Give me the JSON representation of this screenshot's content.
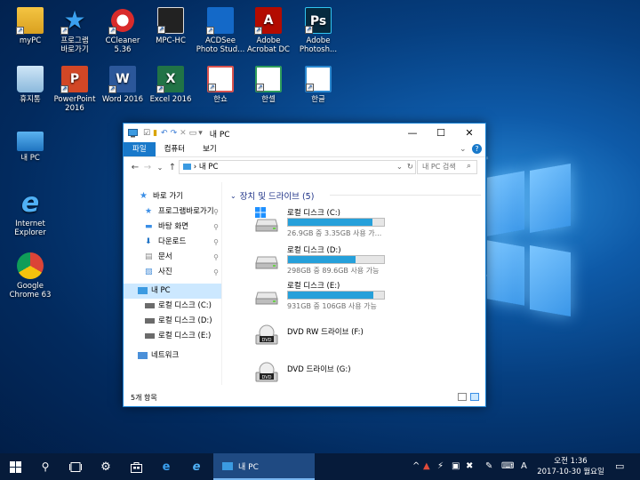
{
  "desktop_icons": [
    {
      "label": "myPC",
      "icon": "user-folder-icon"
    },
    {
      "label": "프로그램\n바로가기",
      "icon": "star-shortcut-icon"
    },
    {
      "label": "CCleaner\n5.36",
      "icon": "ccleaner-icon"
    },
    {
      "label": "MPC-HC",
      "icon": "mpc-hc-icon"
    },
    {
      "label": "ACDSee\nPhoto Stud...",
      "icon": "acdsee-icon"
    },
    {
      "label": "Adobe\nAcrobat DC",
      "icon": "acrobat-icon"
    },
    {
      "label": "Adobe\nPhotosh...",
      "icon": "photoshop-icon"
    },
    {
      "label": "휴지통",
      "icon": "recycle-bin-icon"
    },
    {
      "label": "PowerPoint\n2016",
      "icon": "powerpoint-icon"
    },
    {
      "label": "Word 2016",
      "icon": "word-icon"
    },
    {
      "label": "Excel 2016",
      "icon": "excel-icon"
    },
    {
      "label": "한쇼",
      "icon": "hanshow-icon"
    },
    {
      "label": "한셀",
      "icon": "hancell-icon"
    },
    {
      "label": "한글",
      "icon": "hangul-icon"
    },
    {
      "label": "내 PC",
      "icon": "this-pc-icon"
    },
    {
      "label": "Internet\nExplorer",
      "icon": "internet-explorer-icon"
    },
    {
      "label": "Google\nChrome 63",
      "icon": "chrome-icon"
    }
  ],
  "explorer": {
    "title": "내 PC",
    "ribbon_tabs": [
      "파일",
      "컴퓨터",
      "보기"
    ],
    "address": "내 PC",
    "address_prefix": "›",
    "search_placeholder": "내 PC 검색",
    "nav": {
      "quick_access": "바로 가기",
      "pinned": [
        "프로그램바로가기",
        "바탕 화면",
        "다운로드",
        "문서",
        "사진"
      ],
      "this_pc": "내 PC",
      "drives": [
        "로컬 디스크 (C:)",
        "로컬 디스크 (D:)",
        "로컬 디스크 (E:)"
      ],
      "network": "네트워크"
    },
    "section_title": "장치 및 드라이브 (5)",
    "drives": [
      {
        "name": "로컬 디스크 (C:)",
        "info": "26.9GB 중 3.35GB 사용 가...",
        "used_fraction": 0.88
      },
      {
        "name": "로컬 디스크 (D:)",
        "info": "298GB 중 89.6GB 사용 가능",
        "used_fraction": 0.7
      },
      {
        "name": "로컬 디스크 (E:)",
        "info": "931GB 중 106GB 사용 가능",
        "used_fraction": 0.89
      },
      {
        "name": "DVD RW 드라이브 (F:)",
        "info": "",
        "used_fraction": null
      },
      {
        "name": "DVD 드라이브 (G:)",
        "info": "",
        "used_fraction": null
      }
    ],
    "status": "5개 항목"
  },
  "taskbar": {
    "active_app": "내 PC",
    "ime": "A",
    "time": "오전 1:36",
    "date": "2017-10-30 월요일"
  },
  "colors": {
    "accent": "#1979ca",
    "bar": "#26a0da",
    "taskbar": "#061b3a"
  }
}
